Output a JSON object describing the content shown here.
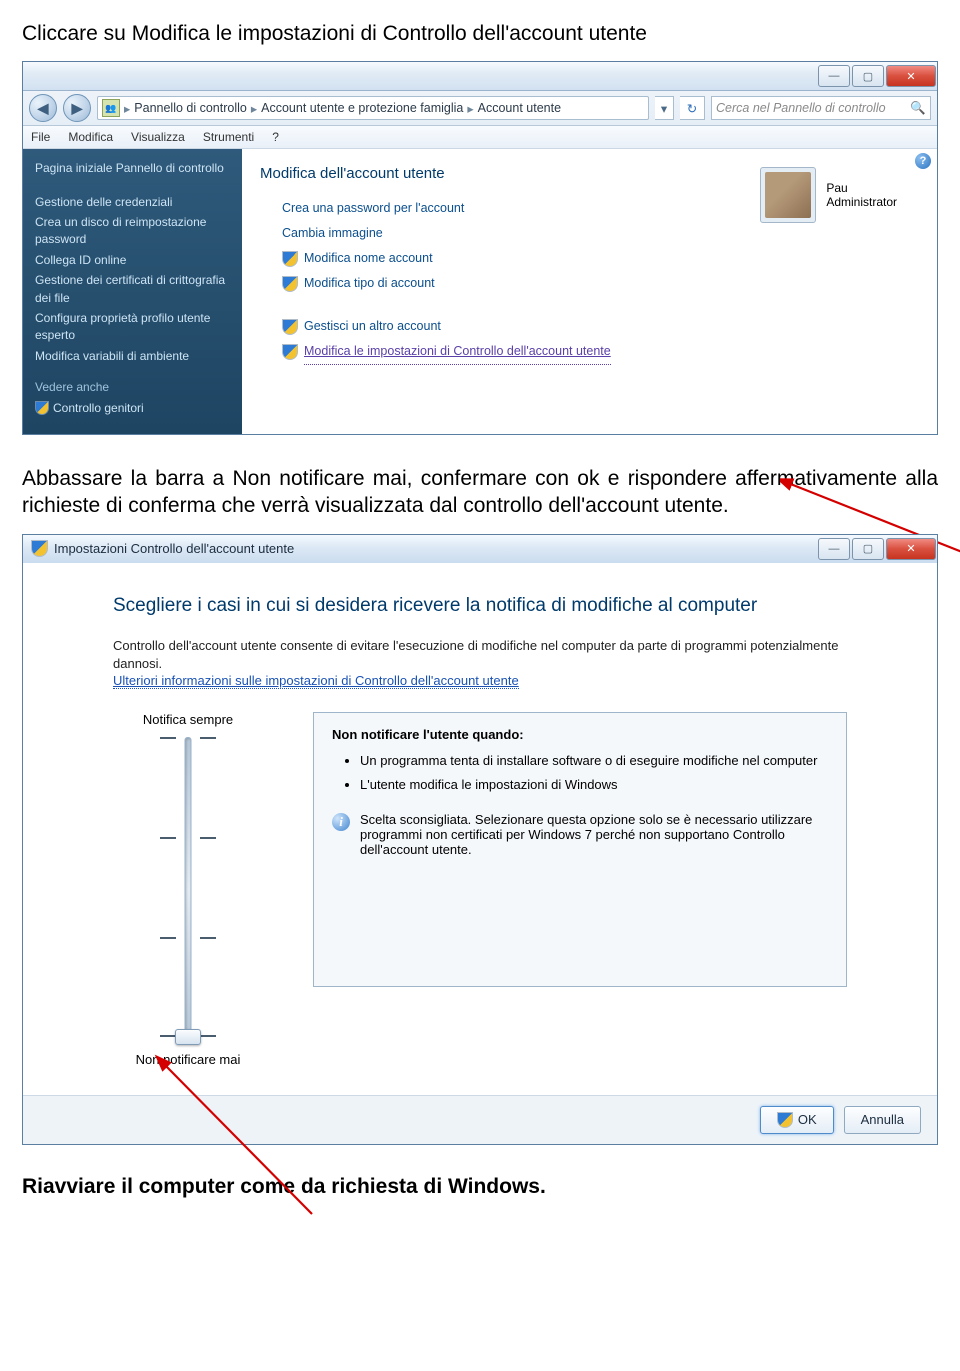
{
  "doc": {
    "line1": "Cliccare su Modifica le impostazioni di Controllo dell'account utente",
    "line2": "Abbassare la barra a Non notificare mai, confermare con ok e rispondere affermativamente alla richieste di conferma che verrà visualizzata dal controllo dell'account utente.",
    "line3": "Riavviare il computer come da richiesta di Windows."
  },
  "win1": {
    "breadcrumb": {
      "seg1": "Pannello di controllo",
      "seg2": "Account utente e protezione famiglia",
      "seg3": "Account utente"
    },
    "search_placeholder": "Cerca nel Pannello di controllo",
    "menu": {
      "file": "File",
      "modifica": "Modifica",
      "visualizza": "Visualizza",
      "strumenti": "Strumenti",
      "help": "?"
    },
    "sidebar": {
      "home": "Pagina iniziale Pannello di controllo",
      "cred": "Gestione delle credenziali",
      "disk": "Crea un disco di reimpostazione password",
      "idonline": "Collega ID online",
      "cert": "Gestione dei certificati di crittografia dei file",
      "profilo": "Configura proprietà profilo utente esperto",
      "env": "Modifica variabili di ambiente",
      "vedere": "Vedere anche",
      "parental": "Controllo genitori"
    },
    "main": {
      "title": "Modifica dell'account utente",
      "create_pwd": "Crea una password per l'account",
      "cambia_img": "Cambia immagine",
      "mod_nome": "Modifica nome account",
      "mod_tipo": "Modifica tipo di account",
      "gestisci": "Gestisci un altro account",
      "uac": "Modifica le impostazioni di Controllo dell'account utente"
    },
    "user": {
      "name": "Pau",
      "role": "Administrator"
    }
  },
  "win2": {
    "title": "Impostazioni Controllo dell'account utente",
    "heading": "Scegliere i casi in cui si desidera ricevere la notifica di modifiche al computer",
    "desc": "Controllo dell'account utente consente di evitare l'esecuzione di modifiche nel computer da parte di programmi potenzialmente dannosi.",
    "link": "Ulteriori informazioni sulle impostazioni di Controllo dell'account utente",
    "top_label": "Notifica sempre",
    "bottom_label": "Non notificare mai",
    "panel_title": "Non notificare l'utente quando:",
    "bullet1": "Un programma tenta di installare software o di eseguire modifiche nel computer",
    "bullet2": "L'utente modifica le impostazioni di Windows",
    "info": "Scelta sconsigliata. Selezionare questa opzione solo se è necessario utilizzare programmi non certificati per Windows 7 perché non supportano Controllo dell'account utente.",
    "ok": "OK",
    "cancel": "Annulla"
  }
}
